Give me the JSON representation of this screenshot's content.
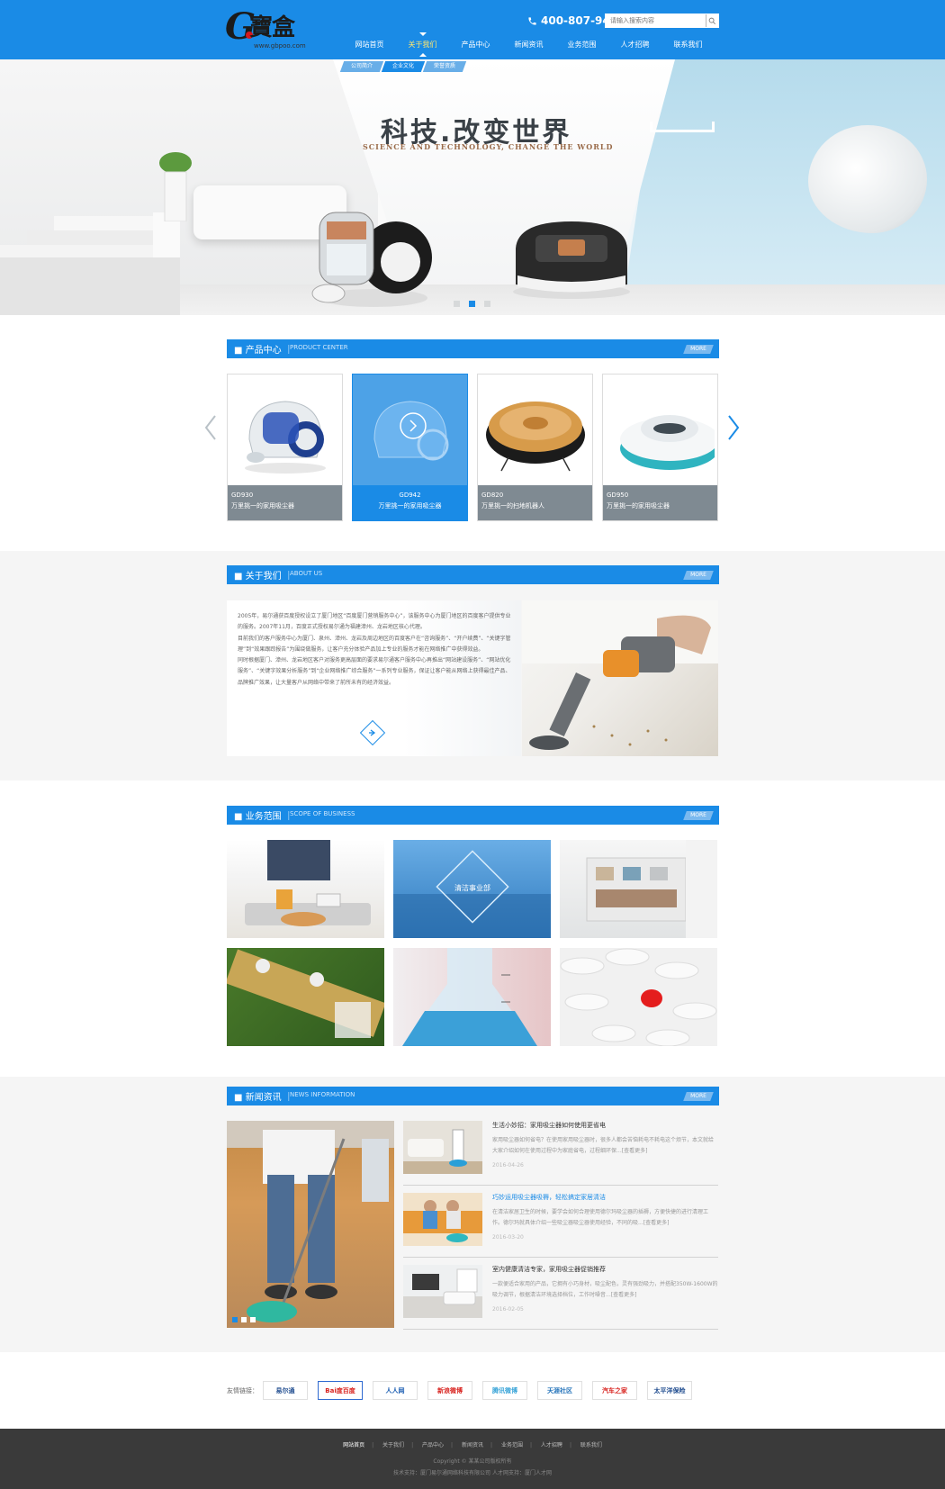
{
  "header": {
    "logo_letter": "G",
    "logo_cn": "寶盒",
    "logo_url": "www.gbpoo.com",
    "phone": "400-807-9400",
    "search_placeholder": "请输入搜索内容",
    "nav": [
      "网站首页",
      "关于我们",
      "产品中心",
      "新闻资讯",
      "业务范围",
      "人才招聘",
      "联系我们"
    ],
    "active_nav": "关于我们",
    "subnav": [
      "公司简介",
      "企业文化",
      "荣誉资质"
    ]
  },
  "banner": {
    "title": "科技.改变世界",
    "subtitle": "SCIENCE AND TECHNOLOGY, CHANGE THE WORLD",
    "slide_count": 3,
    "active_slide": 2
  },
  "products": {
    "title_cn": "产品中心",
    "title_en": "PRODUCT CENTER",
    "more": "MORE",
    "items": [
      {
        "model": "GD930",
        "name": "万里挑一的家用吸尘器"
      },
      {
        "model": "GD942",
        "name": "万里挑一的家用吸尘器"
      },
      {
        "model": "GD820",
        "name": "万里挑一的扫地机器人"
      },
      {
        "model": "GD950",
        "name": "万里挑一的家用吸尘器"
      }
    ]
  },
  "about": {
    "title_cn": "关于我们",
    "title_en": "ABOUT US",
    "more": "MORE",
    "paragraphs": [
      "2005年，易尔通获百度授权设立了厦门地区“百度厦门营销服务中心”，该服务中心为厦门地区的百度客户提供专业的服务。2007年11月，百度正式授权易尔通为福建漳州、龙岩地区核心代理。",
      "目前我们的客户服务中心为厦门、泉州、漳州、龙岩及周边地区的百度客户在“咨询服务”、“开户续费”、“关键字管理”到“效果跟踪报告”为围绕做服务，让客户充分体验产品加上专业的服务才能在网络推广中获得效益。",
      "同时根据厦门、漳州、龙岩地区客户对服务更高层面的要求易尔通客户服务中心再推出“网站建设服务”、“网站优化服务”、“关键字效果分析服务”到“企业网络推广综合服务”一系列专业服务，保证让客户能从网络上获得最佳产品、品牌推广效果，让大量客户从网络中带来了前所未有的经济效益。"
    ]
  },
  "business": {
    "title_cn": "业务范围",
    "title_en": "SCOPE OF BUSINESS",
    "more": "MORE",
    "hover_label": "清洁事业部"
  },
  "news": {
    "title_cn": "新闻资讯",
    "title_en": "NEWS INFORMATION",
    "more": "MORE",
    "slide_count": 3,
    "items": [
      {
        "title": "生活小妙招：家用吸尘器如何使用更省电",
        "desc": "家用吸尘器如何省电？在使用家用吸尘器时，很多人都会苦恼耗电不耗电这个烦节，本文就给大家介绍如何在使用过程中为家庭省电，过程细环保...[查看更多]",
        "date": "2016-04-26"
      },
      {
        "title": "巧妙运用吸尘器吸褥，轻松搞定家居清洁",
        "desc": "在清洁家居卫生的时候，要学会如何合理使用德尔玛吸尘器的插褥，方便快捷的进行清理工作。德尔玛就具体介绍一些吸尘器吸尘器使用经验，不同的吸...[查看更多]",
        "date": "2016-03-20"
      },
      {
        "title": "室内健康清洁专家，家用吸尘器促销推荐",
        "desc": "一款便适合家用的产品，它拥有小巧身材，吸尘配色，灵有强劲吸力，并搭配350W-1600W的吸力调节，根据清洁环境选择档位，工作时噪音...[查看更多]",
        "date": "2016-02-05"
      }
    ]
  },
  "links": {
    "label": "友情链接：",
    "items": [
      "易尔通",
      "Bai度百度",
      "人人网",
      "新浪微博",
      "腾讯微博",
      "天涯社区",
      "汽车之家",
      "太平洋保险"
    ]
  },
  "footer": {
    "nav": [
      "网站首页",
      "关于我们",
      "产品中心",
      "新闻资讯",
      "业务范围",
      "人才招聘",
      "联系我们"
    ],
    "copyright": "Copyright © 某某公司版权所有",
    "tech": "技术支持：厦门易尔通网络科技有限公司   人才网支持：厦门人才网"
  },
  "colors": {
    "brand_blue": "#1a8be6",
    "nav_active": "#ffe66f",
    "footer_bg": "#3a3a3a"
  }
}
